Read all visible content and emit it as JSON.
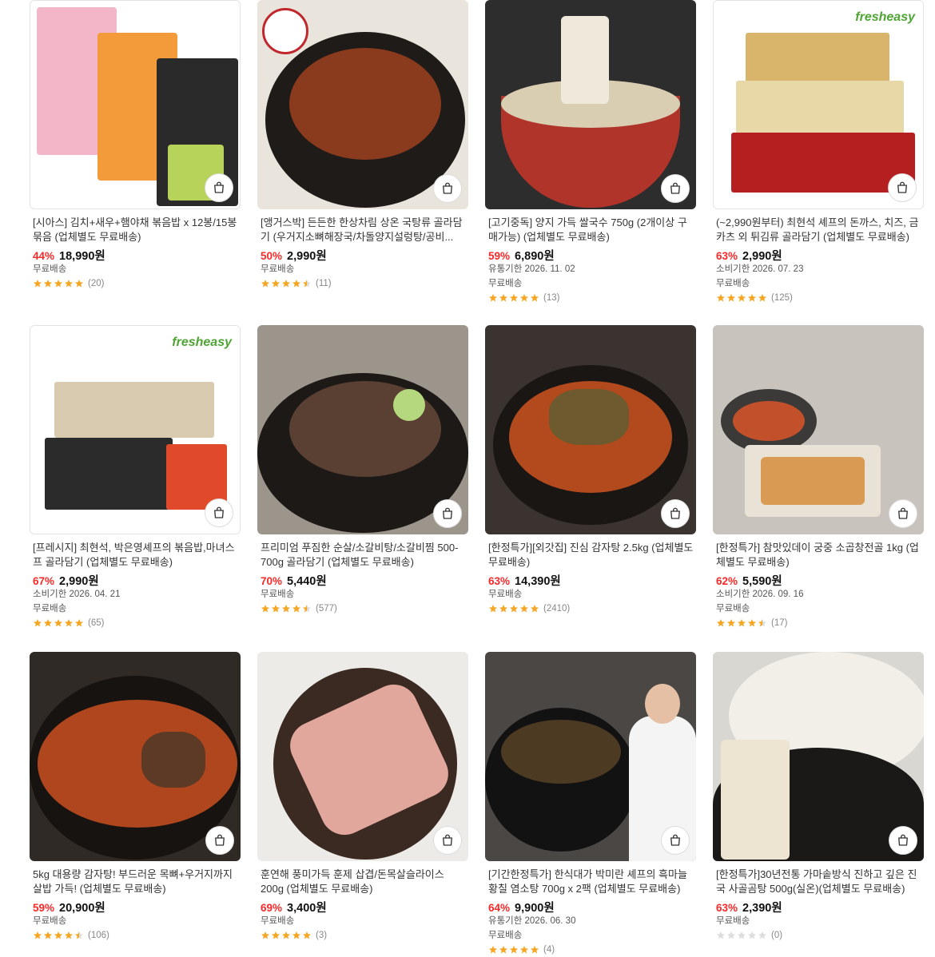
{
  "products": [
    {
      "title": "[시아스] 김치+새우+햄야채 볶음밥 x 12봉/15봉 묶음 (업체별도 무료배송)",
      "discount": "44%",
      "price": "18,990원",
      "expiry": "",
      "shipping": "무료배송",
      "rating": 5,
      "reviews": "(20)",
      "logo": ""
    },
    {
      "title": "[앵거스박] 든든한 한상차림 상온 국탕류 골라담기 (우거지소뼈해장국/차돌양지설렁탕/공비...",
      "discount": "50%",
      "price": "2,990원",
      "expiry": "",
      "shipping": "무료배송",
      "rating": 4.5,
      "reviews": "(11)",
      "logo": ""
    },
    {
      "title": "[고기중독] 양지 가득 쌀국수 750g (2개이상 구매가능) (업체별도 무료배송)",
      "discount": "59%",
      "price": "6,890원",
      "expiry": "유통기한 2026. 11. 02",
      "shipping": "무료배송",
      "rating": 5,
      "reviews": "(13)",
      "logo": ""
    },
    {
      "title": "(~2,990원부터) 최현석 셰프의 돈까스, 치즈, 금카츠 외 튀김류 골라담기 (업체별도 무료배송)",
      "discount": "63%",
      "price": "2,990원",
      "expiry": "소비기한 2026. 07. 23",
      "shipping": "무료배송",
      "rating": 5,
      "reviews": "(125)",
      "logo": "fresheasy"
    },
    {
      "title": "[프레시지] 최현석, 박은영셰프의 볶음밥,마녀스프 골라담기 (업체별도 무료배송)",
      "discount": "67%",
      "price": "2,990원",
      "expiry": "소비기한 2026. 04. 21",
      "shipping": "무료배송",
      "rating": 5,
      "reviews": "(65)",
      "logo": "fresheasy"
    },
    {
      "title": "프리미엄 푸짐한 순살/소갈비탕/소갈비찜 500-700g 골라담기 (업체별도 무료배송)",
      "discount": "70%",
      "price": "5,440원",
      "expiry": "",
      "shipping": "무료배송",
      "rating": 4.5,
      "reviews": "(577)",
      "logo": ""
    },
    {
      "title": "[한정특가][외갓집] 진심 감자탕 2.5kg (업체별도 무료배송)",
      "discount": "63%",
      "price": "14,390원",
      "expiry": "",
      "shipping": "무료배송",
      "rating": 5,
      "reviews": "(2410)",
      "logo": ""
    },
    {
      "title": "[한정특가] 참맛있데이 궁중 소곱창전골 1kg (업체별도 무료배송)",
      "discount": "62%",
      "price": "5,590원",
      "expiry": "소비기한 2026. 09. 16",
      "shipping": "무료배송",
      "rating": 4.5,
      "reviews": "(17)",
      "logo": ""
    },
    {
      "title": "5kg 대용량 감자탕! 부드러운 목뼈+우거지까지 살밥 가득! (업체별도 무료배송)",
      "discount": "59%",
      "price": "20,900원",
      "expiry": "",
      "shipping": "무료배송",
      "rating": 4.5,
      "reviews": "(106)",
      "logo": ""
    },
    {
      "title": "훈연해 풍미가득 훈제 삽겹/돈목살슬라이스 200g (업체별도 무료배송)",
      "discount": "69%",
      "price": "3,400원",
      "expiry": "",
      "shipping": "무료배송",
      "rating": 5,
      "reviews": "(3)",
      "logo": ""
    },
    {
      "title": "[기간한정특가] 한식대가 박미란 셰프의 흑마늘 황칠 염소탕 700g x 2팩 (업체별도 무료배송)",
      "discount": "64%",
      "price": "9,900원",
      "expiry": "유통기한 2026. 06. 30",
      "shipping": "무료배송",
      "rating": 5,
      "reviews": "(4)",
      "logo": ""
    },
    {
      "title": "[한정특가]30년전통 가마솥방식 진하고 깊은 진국 사골곰탕 500g(실온)(업체별도 무료배송)",
      "discount": "63%",
      "price": "2,390원",
      "expiry": "",
      "shipping": "무료배송",
      "rating": 0,
      "reviews": "(0)",
      "logo": ""
    }
  ],
  "colors": {
    "discount": "#fa2828",
    "star": "#f5a623",
    "star_empty": "#dddddd",
    "logo": "#4fa534"
  },
  "icons": {
    "cart": "shopping-bag-icon",
    "star": "star-icon"
  }
}
